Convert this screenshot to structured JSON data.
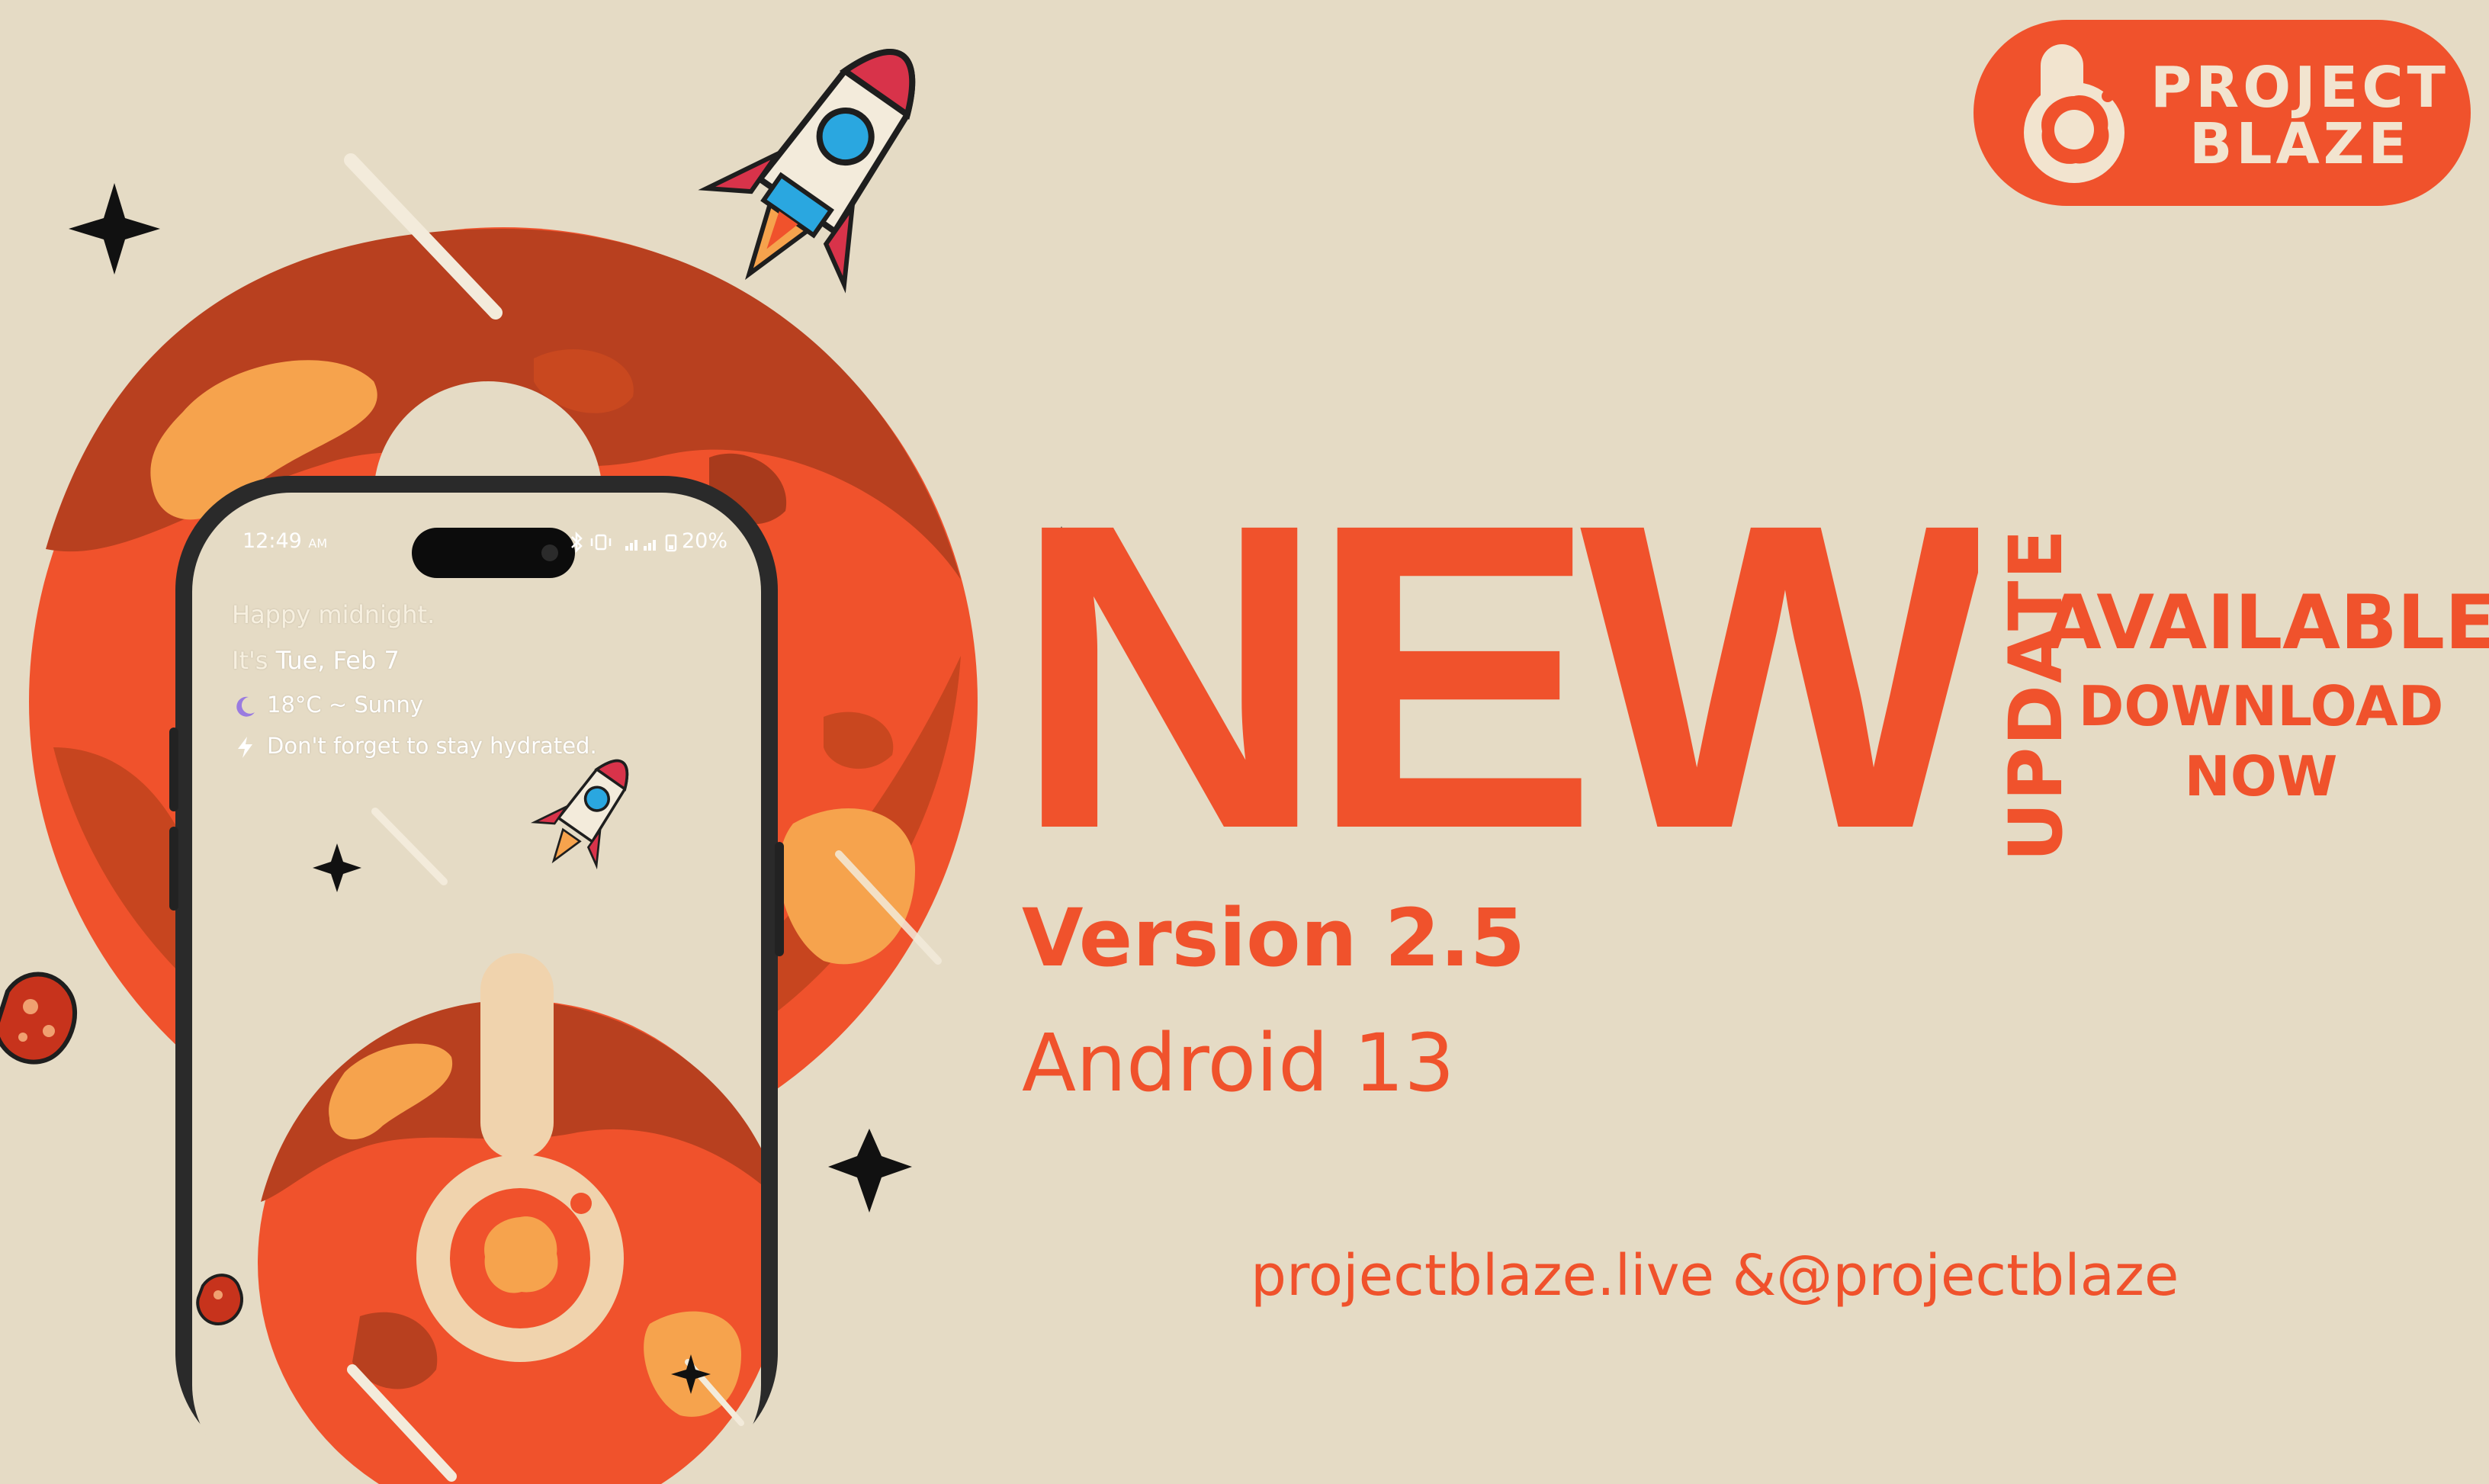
{
  "brand": {
    "logo_line1": "PROJECT",
    "logo_line2": "BLAZE"
  },
  "headline": {
    "new": "NEW",
    "update": "UPDATE",
    "available": "AVAILABLE",
    "download_line1": "DOWNLOAD",
    "download_line2": "NOW"
  },
  "release": {
    "version": "Version 2.5",
    "android": "Android 13"
  },
  "footer": {
    "links": "projectblaze.live &@projectblaze"
  },
  "phone": {
    "status_time": "12:49",
    "status_ampm": "AM",
    "battery": "20%",
    "greeting": "Happy midnight.",
    "date_prefix": "It's",
    "date": "Tue, Feb 7",
    "weather": "18°C ~ Sunny",
    "reminder": "Don't forget to stay hydrated."
  },
  "colors": {
    "background": "#e5dbc5",
    "accent": "#f0522c",
    "planet_dark": "#b8401f",
    "planet_light": "#f6a34d",
    "logo_text": "#f2e4cf",
    "phone_frame": "#2a2a2a"
  },
  "icons": [
    "rocket-icon",
    "sparkle-star-icon",
    "asteroid-icon",
    "planet-illustration",
    "moon-icon",
    "bolt-icon",
    "bluetooth-icon",
    "signal-icon",
    "battery-icon",
    "vibrate-icon"
  ]
}
